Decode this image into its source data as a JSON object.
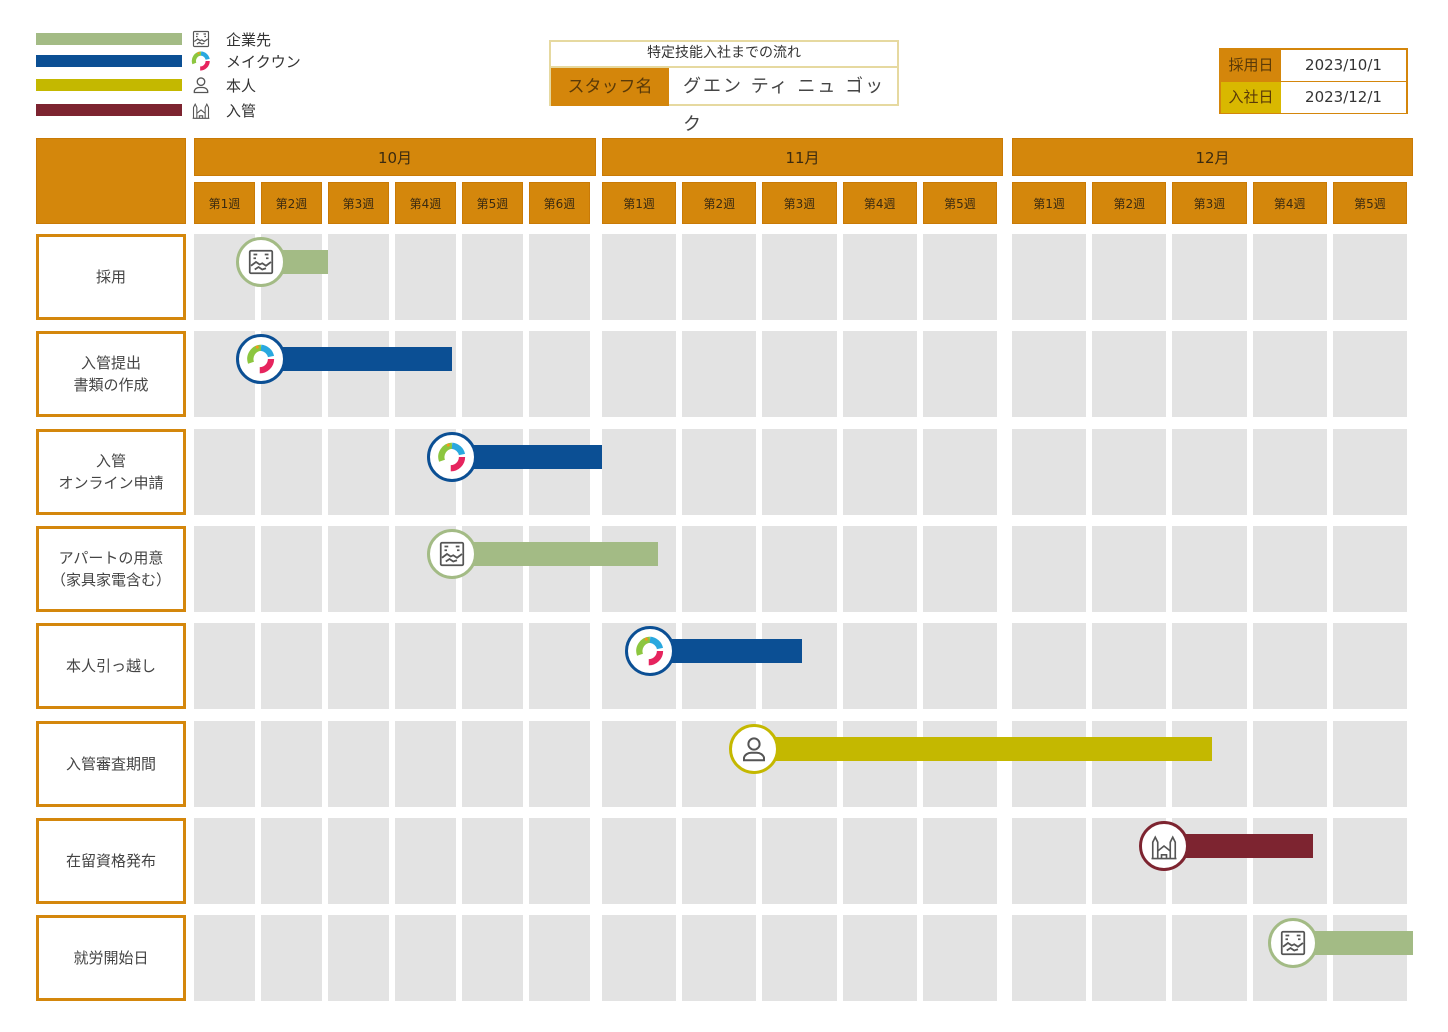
{
  "legend": [
    {
      "key": "company",
      "label": "企業先",
      "color": "#a3bb85",
      "icon": "handshake-building-icon"
    },
    {
      "key": "makewon",
      "label": "メイクウン",
      "color": "#0b4f94",
      "icon": "makewon-logo-icon"
    },
    {
      "key": "self",
      "label": "本人",
      "color": "#c4b800",
      "icon": "person-icon"
    },
    {
      "key": "immigration",
      "label": "入管",
      "color": "#7d2430",
      "icon": "government-building-icon"
    }
  ],
  "title": {
    "heading": "特定技能入社までの流れ",
    "staff_label": "スタッフ名",
    "staff_name": "グエン ティ ニュ ゴック"
  },
  "dates": {
    "hire_label": "採用日",
    "hire_value": "2023/10/1",
    "join_label": "入社日",
    "join_value": "2023/12/1"
  },
  "colors": {
    "header": "#d4870c",
    "cell": "#e3e3e3",
    "join_label_bg": "#d9b800"
  },
  "chart_data": {
    "type": "gantt",
    "title": "特定技能入社までの流れ",
    "months": [
      {
        "label": "10月",
        "weeks": [
          "第1週",
          "第2週",
          "第3週",
          "第4週",
          "第5週",
          "第6週"
        ]
      },
      {
        "label": "11月",
        "weeks": [
          "第1週",
          "第2週",
          "第3週",
          "第4週",
          "第5週"
        ]
      },
      {
        "label": "12月",
        "weeks": [
          "第1週",
          "第2週",
          "第3週",
          "第4週",
          "第5週"
        ]
      }
    ],
    "unit": "week index (0 = start of 10月 第1週, 16 = end of 12月 第5週)",
    "tasks": [
      {
        "label": "採用",
        "owner": "company",
        "start": 1.0,
        "end": 2.0
      },
      {
        "label": "入管提出\n書類の作成",
        "owner": "makewon",
        "start": 1.0,
        "end": 3.85
      },
      {
        "label": "入管\nオンライン申請",
        "owner": "makewon",
        "start": 3.85,
        "end": 6.0
      },
      {
        "label": "アパートの用意\n（家具家電含む）",
        "owner": "company",
        "start": 3.85,
        "end": 6.7
      },
      {
        "label": "本人引っ越し",
        "owner": "makewon",
        "start": 6.6,
        "end": 8.5
      },
      {
        "label": "入管審査期間",
        "owner": "self",
        "start": 7.9,
        "end": 13.5
      },
      {
        "label": "在留資格発布",
        "owner": "immigration",
        "start": 12.9,
        "end": 14.75
      },
      {
        "label": "就労開始日",
        "owner": "company",
        "start": 14.5,
        "end": 16.0
      }
    ]
  }
}
